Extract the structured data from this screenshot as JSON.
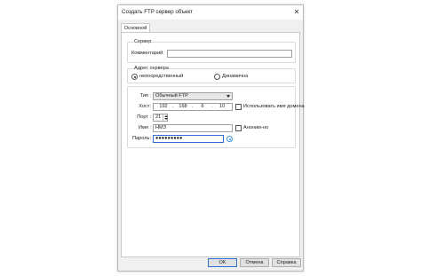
{
  "window": {
    "title": "Создать FTP сервер объект",
    "close_glyph": "✕"
  },
  "tabs": [
    {
      "label": "Основной"
    }
  ],
  "server_group": {
    "title": "Сервер",
    "comment_label": "Комментарий:",
    "comment_value": ""
  },
  "address_group": {
    "title": "Адрес сервера",
    "option_direct": "непосредственный",
    "option_dynamic": "Динамична",
    "selected": "direct"
  },
  "connection": {
    "type_label": "Тип :",
    "type_value": "Обычный FTP",
    "host_label": "Хост:",
    "host_octets": [
      "192",
      "168",
      "6",
      "10"
    ],
    "use_domain_label": "Использовать имя домена",
    "use_domain_checked": false,
    "port_label": "Порт :",
    "port_value": "21",
    "name_label": "Имя :",
    "name_value": "НМЗ",
    "anonymous_label": "Аноним-но",
    "anonymous_checked": false,
    "password_label": "Пароль:",
    "password_value": "●●●●●●●●●"
  },
  "footer": {
    "ok_label": "OK",
    "cancel_label": "Отмена",
    "help_label": "Справка"
  },
  "colors": {
    "accent": "#2f6fd0",
    "eye_icon": "#3b8ed8"
  }
}
